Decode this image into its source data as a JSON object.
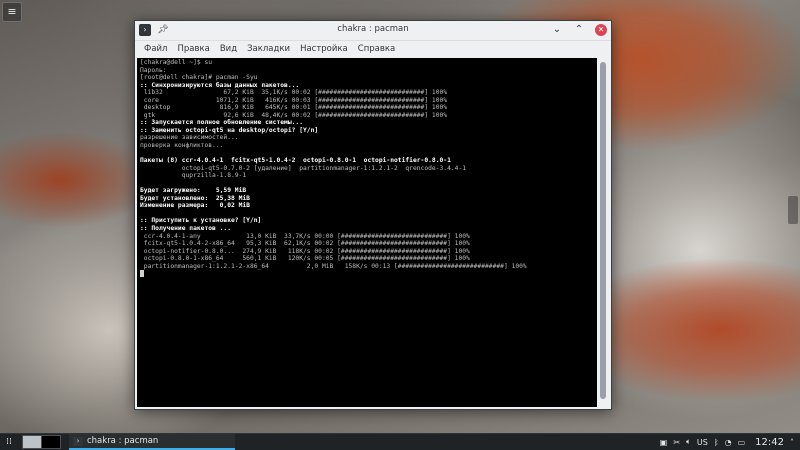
{
  "desktop": {
    "corner_icon": "desktop-toolbox-icon"
  },
  "window": {
    "title": "chakra : pacman",
    "menu": [
      "Файл",
      "Правка",
      "Вид",
      "Закладки",
      "Настройка",
      "Справка"
    ]
  },
  "terminal": {
    "lines": [
      {
        "t": "[chakra@dell ~]$ su"
      },
      {
        "t": "Пароль:"
      },
      {
        "t": "[root@dell chakra]# pacman -Syu"
      },
      {
        "t": ":: Синхронизируются базы данных пакетов...",
        "b": true
      },
      {
        "t": " lib32                67,2 KiB  35,1K/s 00:02 [############################] 100%"
      },
      {
        "t": " core               1071,2 KiB   416K/s 00:03 [############################] 100%"
      },
      {
        "t": " desktop             816,9 KiB   645K/s 00:01 [############################] 100%"
      },
      {
        "t": " gtk                  92,6 KiB  48,4K/s 00:02 [############################] 100%"
      },
      {
        "t": ":: Запускается полное обновление системы...",
        "b": true
      },
      {
        "t": ":: Заменить octopi-qt5 на desktop/octopi? [Y/n]",
        "b": true
      },
      {
        "t": "разрешение зависимостей..."
      },
      {
        "t": "проверка конфликтов..."
      },
      {
        "t": ""
      },
      {
        "t": "Пакеты (8) ccr-4.0.4-1  fcitx-qt5-1.0.4-2  octopi-0.8.0-1  octopi-notifier-0.8.0-1",
        "b": true
      },
      {
        "t": "           octopi-qt5-0.7.0-2 [удаление]  partitionmanager-1:1.2.1-2  qrencode-3.4.4-1"
      },
      {
        "t": "           quprzilla-1.8.9-1"
      },
      {
        "t": ""
      },
      {
        "t": "Будет загружено:    5,59 MiB",
        "b": true
      },
      {
        "t": "Будет установлено:  25,38 MiB",
        "b": true
      },
      {
        "t": "Изменение размера:   0,02 MiB",
        "b": true
      },
      {
        "t": ""
      },
      {
        "t": ":: Приступить к установке? [Y/n]",
        "b": true
      },
      {
        "t": ":: Получение пакетов ...",
        "b": true
      },
      {
        "t": " ccr-4.0.4-1-any            13,0 KiB  33,7K/s 00:00 [############################] 100%"
      },
      {
        "t": " fcitx-qt5-1.0.4-2-x86_64   95,3 KiB  62,1K/s 00:02 [############################] 100%"
      },
      {
        "t": " octopi-notifier-0.8.0...  274,9 KiB   118K/s 00:02 [############################] 100%"
      },
      {
        "t": " octopi-0.8.0-1-x86_64     560,1 KiB   120K/s 00:05 [############################] 100%"
      },
      {
        "t": " partitionmanager-1:1.2.1-2-x86_64          2,0 MiB   158K/s 00:13 [############################] 100%"
      }
    ]
  },
  "taskbar": {
    "launcher_icon": "application-launcher-icon",
    "task_label": "chakra : pacman",
    "tray": {
      "layout": "US",
      "clock": "12:42"
    }
  }
}
